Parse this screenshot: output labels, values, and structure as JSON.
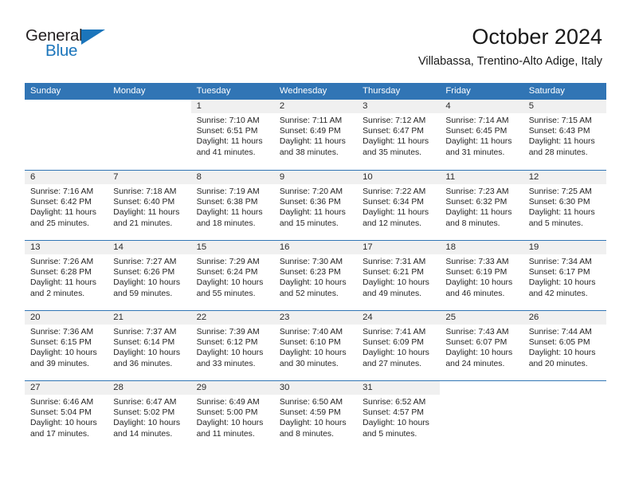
{
  "brand": {
    "name_part1": "General",
    "name_part2": "Blue",
    "accent_color": "#1b75bb"
  },
  "header": {
    "title": "October 2024",
    "subtitle": "Villabassa, Trentino-Alto Adige, Italy"
  },
  "theme": {
    "header_blue": "#3175b5",
    "date_strip_gray": "#f0f0f0",
    "text_color": "#252525"
  },
  "weekdays": [
    "Sunday",
    "Monday",
    "Tuesday",
    "Wednesday",
    "Thursday",
    "Friday",
    "Saturday"
  ],
  "weeks": [
    [
      {
        "date": "",
        "sunrise": "",
        "sunset": "",
        "daylight_line1": "",
        "daylight_line2": ""
      },
      {
        "date": "",
        "sunrise": "",
        "sunset": "",
        "daylight_line1": "",
        "daylight_line2": ""
      },
      {
        "date": "1",
        "sunrise": "Sunrise: 7:10 AM",
        "sunset": "Sunset: 6:51 PM",
        "daylight_line1": "Daylight: 11 hours",
        "daylight_line2": "and 41 minutes."
      },
      {
        "date": "2",
        "sunrise": "Sunrise: 7:11 AM",
        "sunset": "Sunset: 6:49 PM",
        "daylight_line1": "Daylight: 11 hours",
        "daylight_line2": "and 38 minutes."
      },
      {
        "date": "3",
        "sunrise": "Sunrise: 7:12 AM",
        "sunset": "Sunset: 6:47 PM",
        "daylight_line1": "Daylight: 11 hours",
        "daylight_line2": "and 35 minutes."
      },
      {
        "date": "4",
        "sunrise": "Sunrise: 7:14 AM",
        "sunset": "Sunset: 6:45 PM",
        "daylight_line1": "Daylight: 11 hours",
        "daylight_line2": "and 31 minutes."
      },
      {
        "date": "5",
        "sunrise": "Sunrise: 7:15 AM",
        "sunset": "Sunset: 6:43 PM",
        "daylight_line1": "Daylight: 11 hours",
        "daylight_line2": "and 28 minutes."
      }
    ],
    [
      {
        "date": "6",
        "sunrise": "Sunrise: 7:16 AM",
        "sunset": "Sunset: 6:42 PM",
        "daylight_line1": "Daylight: 11 hours",
        "daylight_line2": "and 25 minutes."
      },
      {
        "date": "7",
        "sunrise": "Sunrise: 7:18 AM",
        "sunset": "Sunset: 6:40 PM",
        "daylight_line1": "Daylight: 11 hours",
        "daylight_line2": "and 21 minutes."
      },
      {
        "date": "8",
        "sunrise": "Sunrise: 7:19 AM",
        "sunset": "Sunset: 6:38 PM",
        "daylight_line1": "Daylight: 11 hours",
        "daylight_line2": "and 18 minutes."
      },
      {
        "date": "9",
        "sunrise": "Sunrise: 7:20 AM",
        "sunset": "Sunset: 6:36 PM",
        "daylight_line1": "Daylight: 11 hours",
        "daylight_line2": "and 15 minutes."
      },
      {
        "date": "10",
        "sunrise": "Sunrise: 7:22 AM",
        "sunset": "Sunset: 6:34 PM",
        "daylight_line1": "Daylight: 11 hours",
        "daylight_line2": "and 12 minutes."
      },
      {
        "date": "11",
        "sunrise": "Sunrise: 7:23 AM",
        "sunset": "Sunset: 6:32 PM",
        "daylight_line1": "Daylight: 11 hours",
        "daylight_line2": "and 8 minutes."
      },
      {
        "date": "12",
        "sunrise": "Sunrise: 7:25 AM",
        "sunset": "Sunset: 6:30 PM",
        "daylight_line1": "Daylight: 11 hours",
        "daylight_line2": "and 5 minutes."
      }
    ],
    [
      {
        "date": "13",
        "sunrise": "Sunrise: 7:26 AM",
        "sunset": "Sunset: 6:28 PM",
        "daylight_line1": "Daylight: 11 hours",
        "daylight_line2": "and 2 minutes."
      },
      {
        "date": "14",
        "sunrise": "Sunrise: 7:27 AM",
        "sunset": "Sunset: 6:26 PM",
        "daylight_line1": "Daylight: 10 hours",
        "daylight_line2": "and 59 minutes."
      },
      {
        "date": "15",
        "sunrise": "Sunrise: 7:29 AM",
        "sunset": "Sunset: 6:24 PM",
        "daylight_line1": "Daylight: 10 hours",
        "daylight_line2": "and 55 minutes."
      },
      {
        "date": "16",
        "sunrise": "Sunrise: 7:30 AM",
        "sunset": "Sunset: 6:23 PM",
        "daylight_line1": "Daylight: 10 hours",
        "daylight_line2": "and 52 minutes."
      },
      {
        "date": "17",
        "sunrise": "Sunrise: 7:31 AM",
        "sunset": "Sunset: 6:21 PM",
        "daylight_line1": "Daylight: 10 hours",
        "daylight_line2": "and 49 minutes."
      },
      {
        "date": "18",
        "sunrise": "Sunrise: 7:33 AM",
        "sunset": "Sunset: 6:19 PM",
        "daylight_line1": "Daylight: 10 hours",
        "daylight_line2": "and 46 minutes."
      },
      {
        "date": "19",
        "sunrise": "Sunrise: 7:34 AM",
        "sunset": "Sunset: 6:17 PM",
        "daylight_line1": "Daylight: 10 hours",
        "daylight_line2": "and 42 minutes."
      }
    ],
    [
      {
        "date": "20",
        "sunrise": "Sunrise: 7:36 AM",
        "sunset": "Sunset: 6:15 PM",
        "daylight_line1": "Daylight: 10 hours",
        "daylight_line2": "and 39 minutes."
      },
      {
        "date": "21",
        "sunrise": "Sunrise: 7:37 AM",
        "sunset": "Sunset: 6:14 PM",
        "daylight_line1": "Daylight: 10 hours",
        "daylight_line2": "and 36 minutes."
      },
      {
        "date": "22",
        "sunrise": "Sunrise: 7:39 AM",
        "sunset": "Sunset: 6:12 PM",
        "daylight_line1": "Daylight: 10 hours",
        "daylight_line2": "and 33 minutes."
      },
      {
        "date": "23",
        "sunrise": "Sunrise: 7:40 AM",
        "sunset": "Sunset: 6:10 PM",
        "daylight_line1": "Daylight: 10 hours",
        "daylight_line2": "and 30 minutes."
      },
      {
        "date": "24",
        "sunrise": "Sunrise: 7:41 AM",
        "sunset": "Sunset: 6:09 PM",
        "daylight_line1": "Daylight: 10 hours",
        "daylight_line2": "and 27 minutes."
      },
      {
        "date": "25",
        "sunrise": "Sunrise: 7:43 AM",
        "sunset": "Sunset: 6:07 PM",
        "daylight_line1": "Daylight: 10 hours",
        "daylight_line2": "and 24 minutes."
      },
      {
        "date": "26",
        "sunrise": "Sunrise: 7:44 AM",
        "sunset": "Sunset: 6:05 PM",
        "daylight_line1": "Daylight: 10 hours",
        "daylight_line2": "and 20 minutes."
      }
    ],
    [
      {
        "date": "27",
        "sunrise": "Sunrise: 6:46 AM",
        "sunset": "Sunset: 5:04 PM",
        "daylight_line1": "Daylight: 10 hours",
        "daylight_line2": "and 17 minutes."
      },
      {
        "date": "28",
        "sunrise": "Sunrise: 6:47 AM",
        "sunset": "Sunset: 5:02 PM",
        "daylight_line1": "Daylight: 10 hours",
        "daylight_line2": "and 14 minutes."
      },
      {
        "date": "29",
        "sunrise": "Sunrise: 6:49 AM",
        "sunset": "Sunset: 5:00 PM",
        "daylight_line1": "Daylight: 10 hours",
        "daylight_line2": "and 11 minutes."
      },
      {
        "date": "30",
        "sunrise": "Sunrise: 6:50 AM",
        "sunset": "Sunset: 4:59 PM",
        "daylight_line1": "Daylight: 10 hours",
        "daylight_line2": "and 8 minutes."
      },
      {
        "date": "31",
        "sunrise": "Sunrise: 6:52 AM",
        "sunset": "Sunset: 4:57 PM",
        "daylight_line1": "Daylight: 10 hours",
        "daylight_line2": "and 5 minutes."
      },
      {
        "date": "",
        "sunrise": "",
        "sunset": "",
        "daylight_line1": "",
        "daylight_line2": ""
      },
      {
        "date": "",
        "sunrise": "",
        "sunset": "",
        "daylight_line1": "",
        "daylight_line2": ""
      }
    ]
  ]
}
